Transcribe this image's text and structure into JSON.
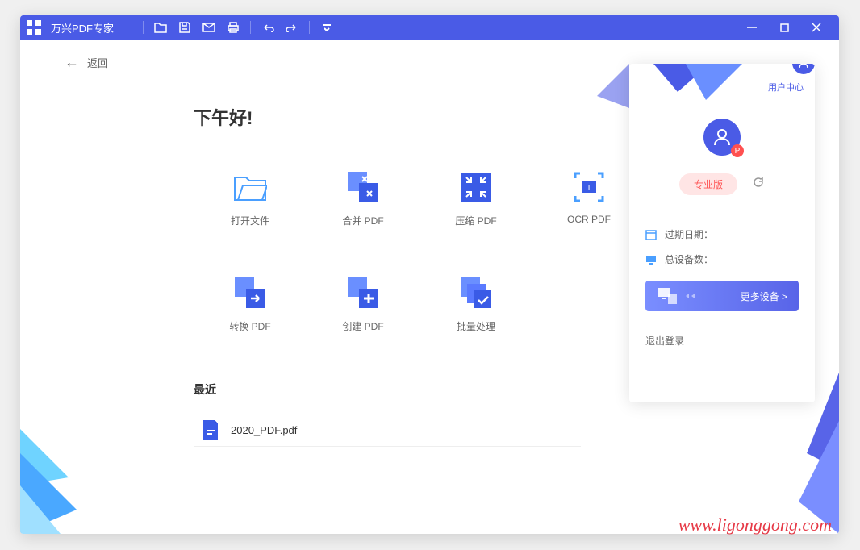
{
  "app": {
    "title": "万兴PDF专家"
  },
  "back": {
    "label": "返回"
  },
  "greeting": "下午好!",
  "actions": [
    {
      "label": "打开文件"
    },
    {
      "label": "合并 PDF"
    },
    {
      "label": "压缩 PDF"
    },
    {
      "label": "OCR PDF"
    },
    {
      "label": "转换 PDF"
    },
    {
      "label": "创建 PDF"
    },
    {
      "label": "批量处理"
    }
  ],
  "recent": {
    "title": "最近",
    "items": [
      {
        "name": "2020_PDF.pdf"
      }
    ]
  },
  "userPanel": {
    "centerLink": "用户中心",
    "proBadge": "专业版",
    "avatarBadge": "P",
    "expireLabel": "过期日期：",
    "deviceCountLabel": "总设备数：",
    "moreDevices": "更多设备 >",
    "logout": "退出登录"
  },
  "watermark": "www.ligonggong.com"
}
